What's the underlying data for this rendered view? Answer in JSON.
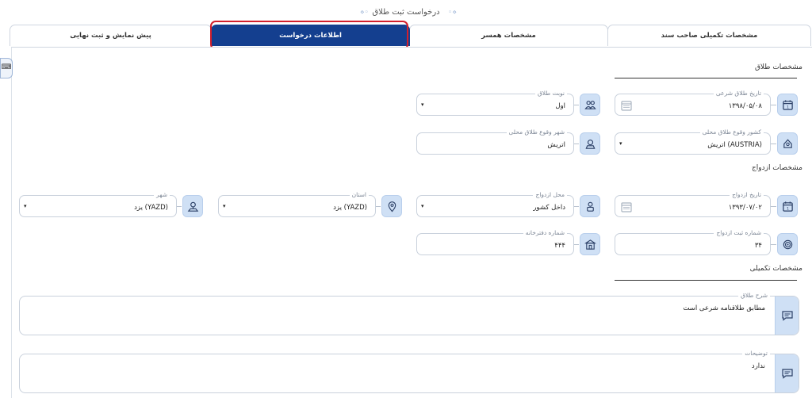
{
  "page_title": "درخواست ثبت طلاق",
  "tabs": [
    {
      "label": "مشخصات تکمیلی صاحب سند",
      "active": false
    },
    {
      "label": "مشخصات همسر",
      "active": false
    },
    {
      "label": "اطلاعات درخواست",
      "active": true
    },
    {
      "label": "پیش نمایش و ثبت نهایی",
      "active": false
    }
  ],
  "side_tool": {
    "icon": "keyboard-icon",
    "glyph": "⌨"
  },
  "sections": {
    "divorce": "مشخصات طلاق",
    "marriage": "مشخصات ازدواج",
    "extra": "مشخصات تکمیلی"
  },
  "fields": {
    "divorce_date": {
      "label": "تاریخ طلاق شرعی",
      "value": "۱۳۹۸/۰۵/۰۸"
    },
    "divorce_turn": {
      "label": "نوبت طلاق",
      "value": "اول"
    },
    "divorce_country": {
      "label": "کشور وقوع طلاق محلی",
      "value": "اتریش (AUSTRIA)"
    },
    "divorce_city": {
      "label": "شهر وقوع طلاق محلی",
      "value": "اتریش"
    },
    "marriage_date": {
      "label": "تاریخ ازدواج",
      "value": "۱۳۹۳/۰۷/۰۲"
    },
    "marriage_place": {
      "label": "محل ازدواج",
      "value": "داخل کشور"
    },
    "province": {
      "label": "استان",
      "value": "یزد (YAZD)"
    },
    "city": {
      "label": "شهر",
      "value": "یزد (YAZD)"
    },
    "marriage_reg_no": {
      "label": "شماره ثبت ازدواج",
      "value": "۳۴"
    },
    "office_no": {
      "label": "شماره دفترخانه",
      "value": "۴۴۴"
    },
    "divorce_description": {
      "label": "شرح طلاق",
      "value": "مطابق طلاقنامه شرعی است"
    },
    "notes": {
      "label": "توضیحات",
      "value": "ندارد"
    }
  },
  "caret": "▾",
  "colors": {
    "accent": "#143f8f",
    "highlight": "#d21f2c",
    "icon_bg": "#cfe0f5"
  }
}
